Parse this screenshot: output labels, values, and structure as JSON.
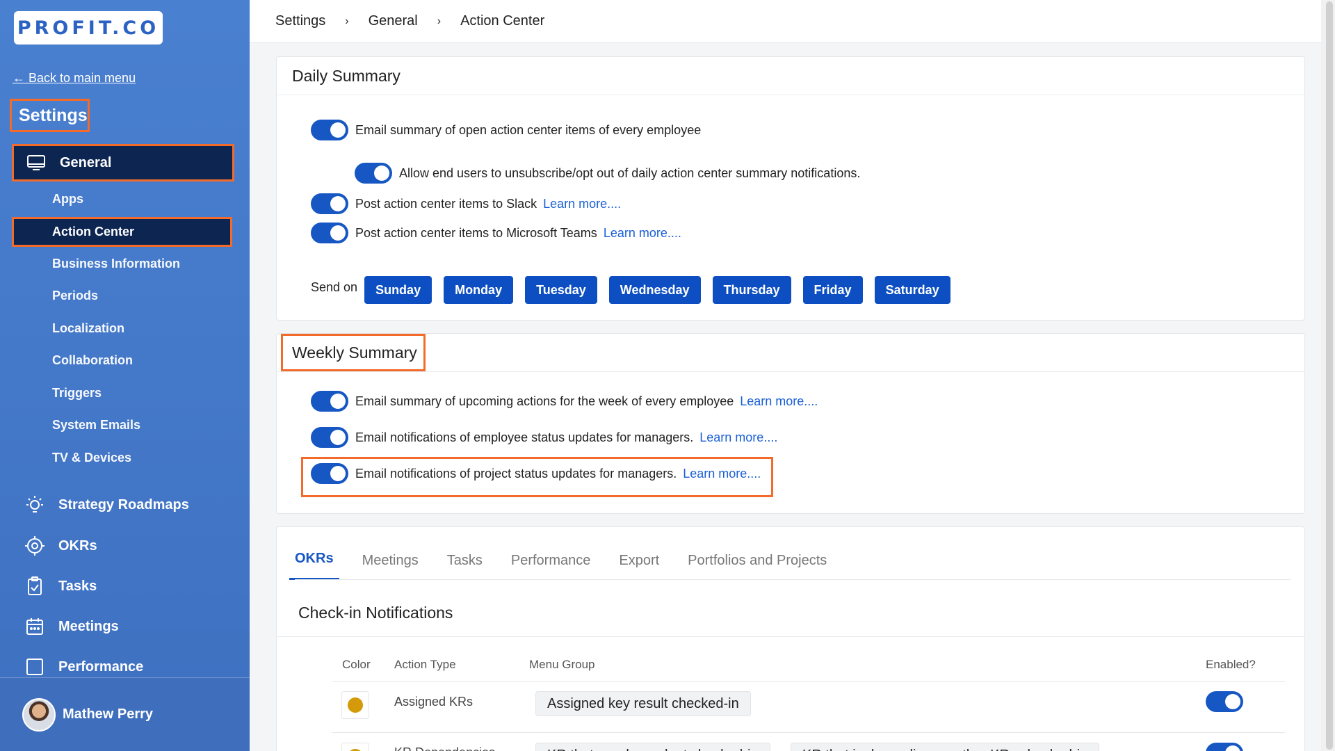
{
  "brand": {
    "logo_text": "PROFIT.CO"
  },
  "sidebar": {
    "back_label": "← Back to main menu",
    "settings_title": "Settings",
    "general_label": "General",
    "sub_items": [
      "Apps",
      "Action Center",
      "Business Information",
      "Periods",
      "Localization",
      "Collaboration",
      "Triggers",
      "System Emails",
      "TV & Devices"
    ],
    "main_items": [
      "Strategy Roadmaps",
      "OKRs",
      "Tasks",
      "Meetings",
      "Performance"
    ],
    "user_name": "Mathew Perry"
  },
  "breadcrumb": [
    "Settings",
    "General",
    "Action Center"
  ],
  "daily_summary": {
    "title": "Daily Summary",
    "items": [
      "Email summary of open action center items of every employee",
      "Allow end users to unsubscribe/opt out of daily action center summary notifications.",
      "Post action center items to Slack",
      "Post action center items to Microsoft Teams"
    ],
    "learn_more": "Learn more....",
    "send_on_label": "Send on",
    "days": [
      "Sunday",
      "Monday",
      "Tuesday",
      "Wednesday",
      "Thursday",
      "Friday",
      "Saturday"
    ]
  },
  "weekly_summary": {
    "title": "Weekly Summary",
    "items": [
      "Email summary of upcoming actions for the week of every employee",
      "Email notifications of employee status updates for managers.",
      "Email notifications of project status updates for managers."
    ],
    "learn_more": "Learn more...."
  },
  "tabs": [
    "OKRs",
    "Meetings",
    "Tasks",
    "Performance",
    "Export",
    "Portfolios and Projects"
  ],
  "checkin": {
    "title": "Check-in Notifications",
    "columns": [
      "Color",
      "Action Type",
      "Menu Group",
      "Enabled?"
    ],
    "rows": [
      {
        "action_type": "Assigned KRs",
        "menu_group": "Assigned key result checked-in",
        "dot_color": "#d49a0a"
      },
      {
        "action_type": "KR Dependencies",
        "menu_group": "KR that are dependent checked-in",
        "menu_group_2": "KR that is depending on other KRs checked-in",
        "dot_color": "#d49a0a"
      }
    ]
  },
  "colors": {
    "accent": "#1657c3",
    "highlight": "#f26b2a",
    "sidebar": "#4a80d0",
    "active_nav": "#0c2551"
  }
}
